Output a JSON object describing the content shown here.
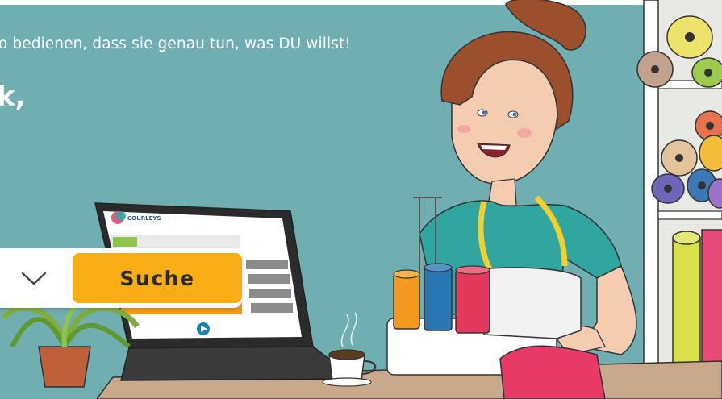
{
  "hero": {
    "subtitle": "o bedienen, dass sie genau tun, was DU willst!",
    "headline": "k,"
  },
  "search": {
    "button_label": "Suche",
    "dropdown_icon": "chevron-down-icon"
  },
  "laptop_screen": {
    "brand": "COURLEYS",
    "play_icon": "play-icon"
  },
  "colors": {
    "background": "#6faeb1",
    "button": "#f7ae14",
    "headline": "#ffffff"
  }
}
